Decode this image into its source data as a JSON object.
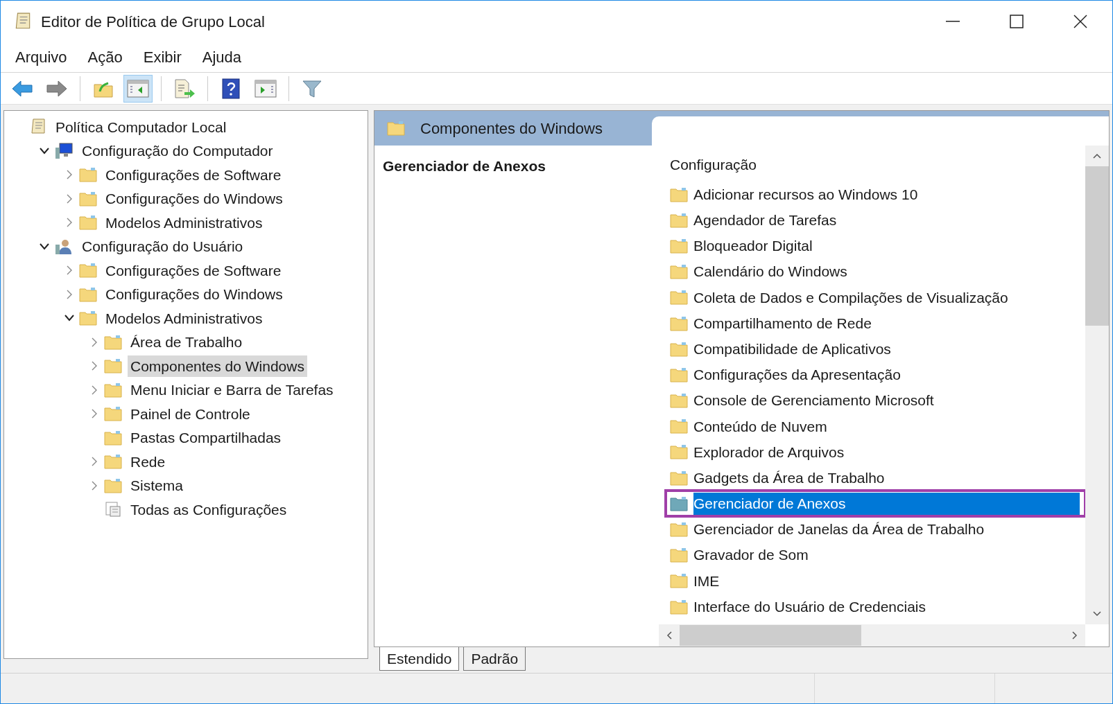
{
  "window": {
    "title": "Editor de Política de Grupo Local"
  },
  "menu": [
    "Arquivo",
    "Ação",
    "Exibir",
    "Ajuda"
  ],
  "toolbar": [
    {
      "kind": "back"
    },
    {
      "kind": "forward"
    },
    {
      "kind": "sep"
    },
    {
      "kind": "up"
    },
    {
      "kind": "tree",
      "selected": true
    },
    {
      "kind": "sep"
    },
    {
      "kind": "export"
    },
    {
      "kind": "sep"
    },
    {
      "kind": "help"
    },
    {
      "kind": "pane"
    },
    {
      "kind": "sep"
    },
    {
      "kind": "filter"
    }
  ],
  "tree": [
    {
      "label": "Política Computador Local",
      "kind": "policy",
      "selected": false,
      "children": [
        {
          "label": "Configuração do Computador",
          "kind": "computer",
          "expanded": true,
          "selected": false,
          "children": [
            {
              "label": "Configurações de Software",
              "kind": "folder",
              "expanded": false,
              "selected": false
            },
            {
              "label": "Configurações do Windows",
              "kind": "folder",
              "expanded": false,
              "selected": false
            },
            {
              "label": "Modelos Administrativos",
              "kind": "folder",
              "expanded": false,
              "selected": false
            }
          ]
        },
        {
          "label": "Configuração do Usuário",
          "kind": "user",
          "expanded": true,
          "selected": false,
          "children": [
            {
              "label": "Configurações de Software",
              "kind": "folder",
              "expanded": false,
              "selected": false
            },
            {
              "label": "Configurações do Windows",
              "kind": "folder",
              "expanded": false,
              "selected": false
            },
            {
              "label": "Modelos Administrativos",
              "kind": "folder",
              "expanded": true,
              "selected": false,
              "children": [
                {
                  "label": "Área de Trabalho",
                  "kind": "folder",
                  "expanded": false,
                  "selected": false
                },
                {
                  "label": "Componentes do Windows",
                  "kind": "folder",
                  "expanded": false,
                  "selected": true
                },
                {
                  "label": "Menu Iniciar e Barra de Tarefas",
                  "kind": "folder",
                  "expanded": false,
                  "selected": false
                },
                {
                  "label": "Painel de Controle",
                  "kind": "folder",
                  "expanded": false,
                  "selected": false
                },
                {
                  "label": "Pastas Compartilhadas",
                  "kind": "folder",
                  "selected": false
                },
                {
                  "label": "Rede",
                  "kind": "folder",
                  "expanded": false,
                  "selected": false
                },
                {
                  "label": "Sistema",
                  "kind": "folder",
                  "expanded": false,
                  "selected": false
                },
                {
                  "label": "Todas as Configurações",
                  "kind": "settings",
                  "selected": false
                }
              ]
            }
          ]
        }
      ]
    }
  ],
  "details": {
    "header": "Componentes do Windows",
    "heading": "Gerenciador de Anexos",
    "column": "Configuração",
    "items": [
      {
        "label": "Adicionar recursos ao Windows 10",
        "selected": false
      },
      {
        "label": "Agendador de Tarefas",
        "selected": false
      },
      {
        "label": "Bloqueador Digital",
        "selected": false
      },
      {
        "label": "Calendário do Windows",
        "selected": false
      },
      {
        "label": "Coleta de Dados e Compilações de Visualização",
        "selected": false
      },
      {
        "label": "Compartilhamento de Rede",
        "selected": false
      },
      {
        "label": "Compatibilidade de Aplicativos",
        "selected": false
      },
      {
        "label": "Configurações da Apresentação",
        "selected": false
      },
      {
        "label": "Console de Gerenciamento Microsoft",
        "selected": false
      },
      {
        "label": "Conteúdo de Nuvem",
        "selected": false
      },
      {
        "label": "Explorador de Arquivos",
        "selected": false
      },
      {
        "label": "Gadgets da Área de Trabalho",
        "selected": false
      },
      {
        "label": "Gerenciador de Anexos",
        "selected": true
      },
      {
        "label": "Gerenciador de Janelas da Área de Trabalho",
        "selected": false
      },
      {
        "label": "Gravador de Som",
        "selected": false
      },
      {
        "label": "IME",
        "selected": false
      },
      {
        "label": "Interface do Usuário de Credenciais",
        "selected": false
      }
    ],
    "tabs": [
      {
        "label": "Estendido",
        "selected": true
      },
      {
        "label": "Padrão",
        "selected": false
      }
    ]
  }
}
